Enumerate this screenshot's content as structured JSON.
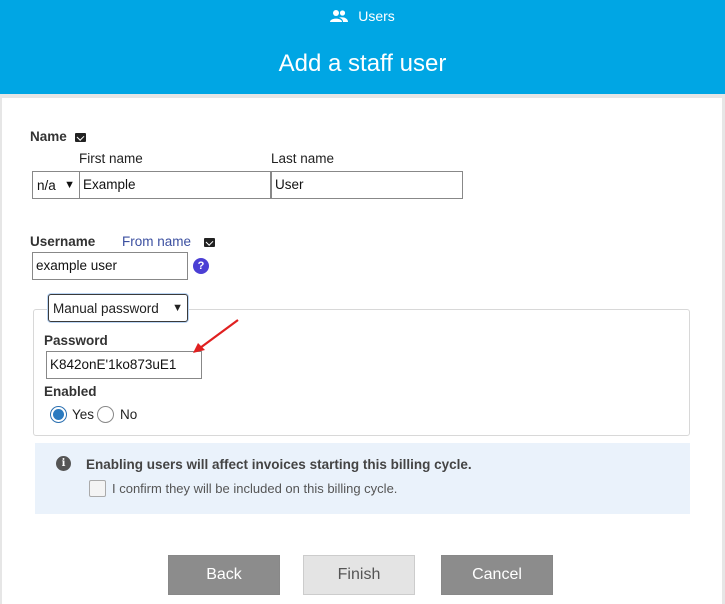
{
  "header": {
    "crumb_icon": "users-icon",
    "crumb_label": "Users",
    "title": "Add a staff user"
  },
  "name_section": {
    "label": "Name",
    "title_select_value": "n/a",
    "first_name_label": "First name",
    "first_name_value": "Example",
    "last_name_label": "Last name",
    "last_name_value": "User"
  },
  "username_section": {
    "label": "Username",
    "from_name_label": "From name",
    "value": "example user",
    "help_icon": "help-icon"
  },
  "password_section": {
    "mode_select_value": "Manual password",
    "password_label": "Password",
    "password_value": "K842onE'1ko873uE1",
    "enabled_label": "Enabled",
    "yes_label": "Yes",
    "no_label": "No",
    "enabled_selected": "Yes"
  },
  "info_box": {
    "icon": "info-icon",
    "message": "Enabling users will affect invoices starting this billing cycle.",
    "confirm_label": "I confirm they will be included on this billing cycle.",
    "confirm_checked": false
  },
  "buttons": {
    "back": "Back",
    "finish": "Finish",
    "cancel": "Cancel"
  },
  "colors": {
    "header_bg": "#00a6e4",
    "annotation_arrow": "#e02020"
  }
}
